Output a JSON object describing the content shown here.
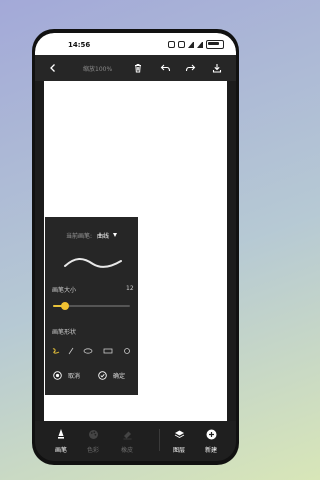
{
  "status": {
    "time": "14:56"
  },
  "toolbar": {
    "zoom": "缩放100%"
  },
  "panel": {
    "current_brush_label": "当前画笔:",
    "current_brush_value": "曲线",
    "size_label": "画笔大小",
    "size_value": "12",
    "size_level": 0.16,
    "shape_label": "画笔形状",
    "cancel": "取消",
    "confirm": "确定"
  },
  "bottom": {
    "brush": "画笔",
    "color": "色彩",
    "eraser": "橡皮",
    "layers": "图层",
    "new": "新建"
  },
  "colors": {
    "accent": "#f1c232",
    "panel_bg": "#262626",
    "toolbar_bg": "#262626"
  }
}
